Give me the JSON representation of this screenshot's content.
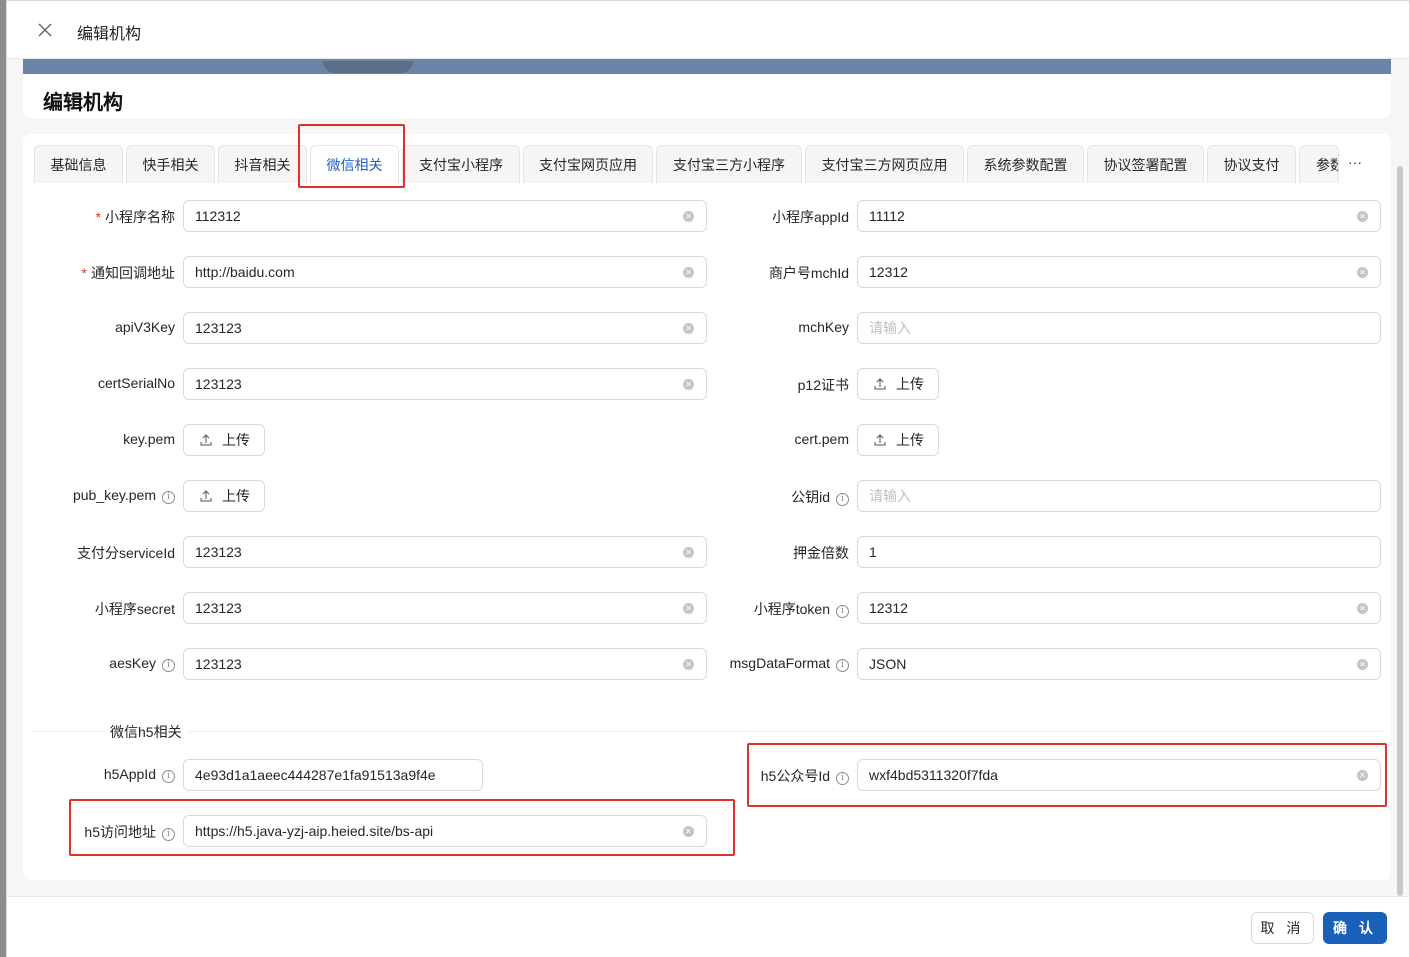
{
  "header": {
    "title": "编辑机构"
  },
  "page": {
    "title": "编辑机构"
  },
  "tabs": [
    {
      "label": "基础信息"
    },
    {
      "label": "快手相关"
    },
    {
      "label": "抖音相关"
    },
    {
      "label": "微信相关"
    },
    {
      "label": "支付宝小程序"
    },
    {
      "label": "支付宝网页应用"
    },
    {
      "label": "支付宝三方小程序"
    },
    {
      "label": "支付宝三方网页应用"
    },
    {
      "label": "系统参数配置"
    },
    {
      "label": "协议签署配置"
    },
    {
      "label": "协议支付"
    },
    {
      "label": "参数"
    }
  ],
  "tabs_more": "···",
  "active_tab": "微信相关",
  "upload_label": "上传",
  "fields": {
    "mini_name": {
      "label": "小程序名称",
      "value": "112312",
      "required": true
    },
    "mini_appid": {
      "label": "小程序appId",
      "value": "11112"
    },
    "notify_url": {
      "label": "通知回调地址",
      "value": "http://baidu.com",
      "required": true
    },
    "mchid": {
      "label": "商户号mchId",
      "value": "12312"
    },
    "apiv3key": {
      "label": "apiV3Key",
      "value": "123123"
    },
    "mchkey": {
      "label": "mchKey",
      "placeholder": "请输入"
    },
    "cert_serial": {
      "label": "certSerialNo",
      "value": "123123"
    },
    "p12": {
      "label": "p12证书"
    },
    "key_pem": {
      "label": "key.pem"
    },
    "cert_pem": {
      "label": "cert.pem"
    },
    "pub_key_pem": {
      "label": "pub_key.pem"
    },
    "pub_key_id": {
      "label": "公钥id",
      "placeholder": "请输入"
    },
    "service_id": {
      "label": "支付分serviceId",
      "value": "123123"
    },
    "deposit_multiple": {
      "label": "押金倍数",
      "value": "1"
    },
    "mini_secret": {
      "label": "小程序secret",
      "value": "123123"
    },
    "mini_token": {
      "label": "小程序token",
      "value": "12312"
    },
    "aes_key": {
      "label": "aesKey",
      "value": "123123"
    },
    "msg_format": {
      "label": "msgDataFormat",
      "value": "JSON"
    },
    "h5_appid": {
      "label": "h5AppId",
      "value": "4e93d1a1aeec444287e1fa91513a9f4e"
    },
    "h5_mp_id": {
      "label": "h5公众号Id",
      "value": "wxf4bd5311320f7fda"
    },
    "h5_url": {
      "label": "h5访问地址",
      "value": "https://h5.java-yzj-aip.heied.site/bs-api"
    }
  },
  "section": {
    "h5_title": "微信h5相关"
  },
  "footer": {
    "cancel": "取 消",
    "ok": "确 认"
  },
  "colors": {
    "primary": "#1860b8",
    "highlight": "#e0312b",
    "required": "#e0312b"
  }
}
